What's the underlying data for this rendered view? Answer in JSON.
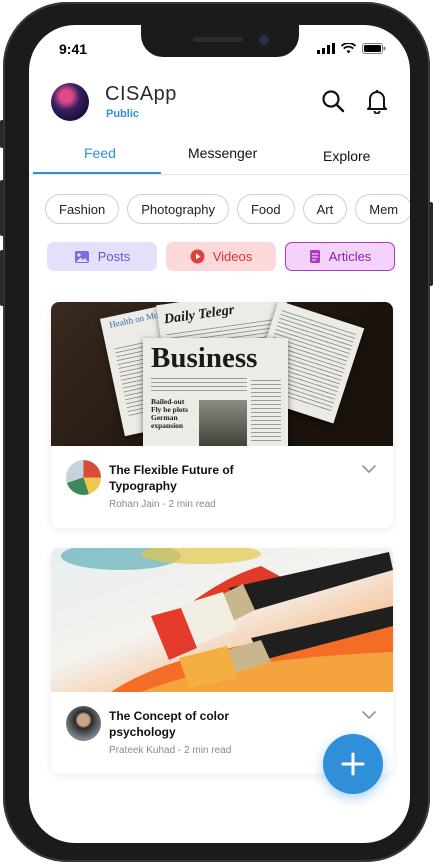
{
  "status": {
    "time": "9:41"
  },
  "header": {
    "title": "CISApp",
    "subtitle": "Public"
  },
  "tabs": [
    {
      "label": "Feed",
      "active": true
    },
    {
      "label": "Messenger",
      "active": false
    },
    {
      "label": "Explore",
      "active": false
    }
  ],
  "categories": [
    "Fashion",
    "Photography",
    "Food",
    "Art",
    "Mem"
  ],
  "content_types": [
    {
      "label": "Posts",
      "icon": "image-icon"
    },
    {
      "label": "Videos",
      "icon": "play-circle-icon"
    },
    {
      "label": "Articles",
      "icon": "document-icon",
      "selected": true
    }
  ],
  "newspaper_headlines": {
    "business": "Business",
    "telegraph": "Daily Telegr",
    "health": "Health on Monday",
    "bailed": "Bailed-out Fly be plots German expansion"
  },
  "articles": [
    {
      "title": "The Flexible Future of Typography",
      "author": "Rohan Jain",
      "read_time": "2 min read",
      "meta": "Rohan Jain - 2 min read"
    },
    {
      "title": "The Concept of color psychology",
      "author": "Prateek Kuhad",
      "read_time": "2 min read",
      "meta": "Prateek Kuhad - 2 min read"
    }
  ],
  "colors": {
    "accent": "#2f8fd8",
    "posts": "#6558c5",
    "videos": "#d7342f",
    "articles": "#8e1fa8"
  }
}
